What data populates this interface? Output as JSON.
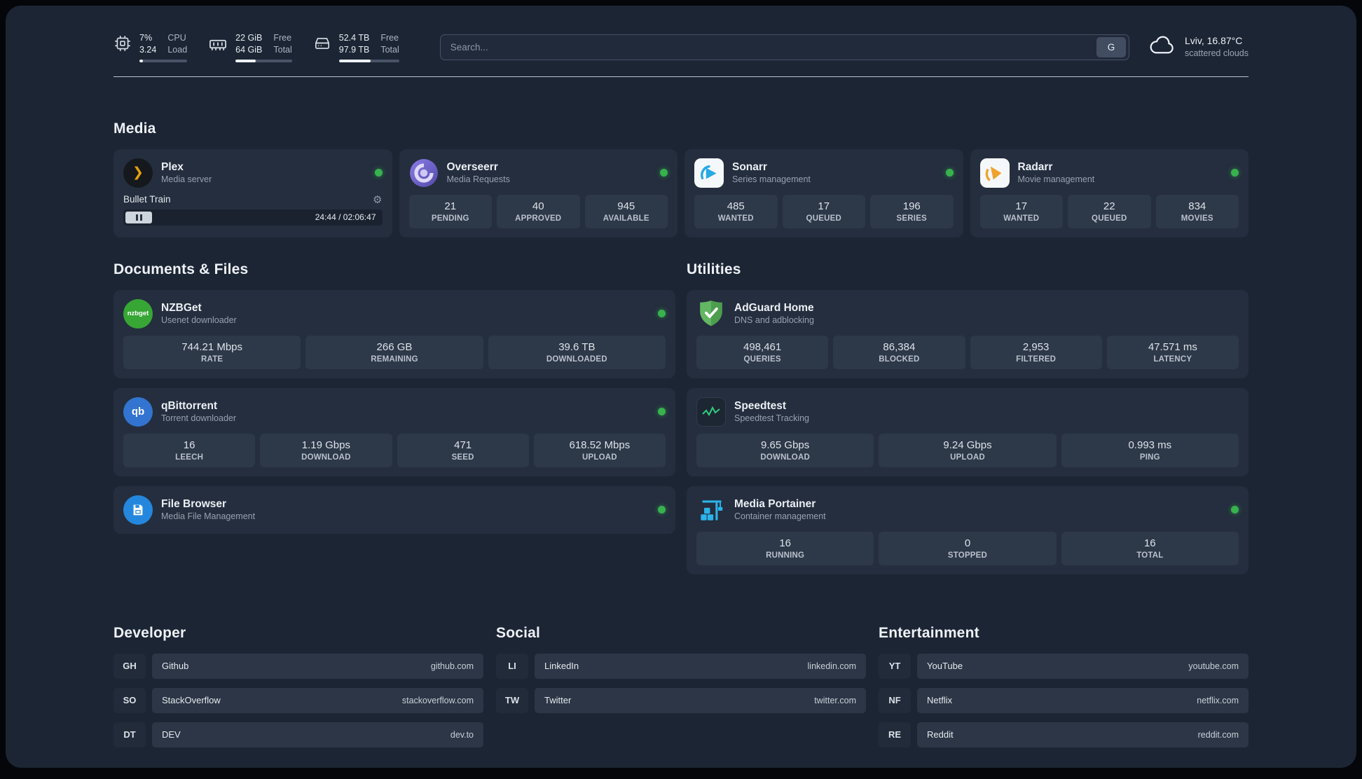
{
  "topbar": {
    "cpu": {
      "value": "7%",
      "sub": "3.24",
      "labels": [
        "CPU",
        "Load"
      ],
      "progress": 8
    },
    "ram": {
      "value": "22 GiB",
      "sub": "64 GiB",
      "labels": [
        "Free",
        "Total"
      ],
      "progress": 36
    },
    "disk": {
      "value": "52.4 TB",
      "sub": "97.9 TB",
      "labels": [
        "Free",
        "Total"
      ],
      "progress": 53
    },
    "search": {
      "placeholder": "Search...",
      "button_label": "G"
    },
    "weather": {
      "location": "Lviv, 16.87°C",
      "condition": "scattered clouds"
    }
  },
  "sections": {
    "media": "Media",
    "documents": "Documents & Files",
    "utilities": "Utilities",
    "developer": "Developer",
    "social": "Social",
    "entertainment": "Entertainment"
  },
  "apps": {
    "plex": {
      "name": "Plex",
      "subtitle": "Media server",
      "now_playing": "Bullet Train",
      "time": "24:44 / 02:06:47"
    },
    "overseerr": {
      "name": "Overseerr",
      "subtitle": "Media Requests",
      "stats": [
        {
          "value": "21",
          "label": "PENDING"
        },
        {
          "value": "40",
          "label": "APPROVED"
        },
        {
          "value": "945",
          "label": "AVAILABLE"
        }
      ]
    },
    "sonarr": {
      "name": "Sonarr",
      "subtitle": "Series management",
      "stats": [
        {
          "value": "485",
          "label": "WANTED"
        },
        {
          "value": "17",
          "label": "QUEUED"
        },
        {
          "value": "196",
          "label": "SERIES"
        }
      ]
    },
    "radarr": {
      "name": "Radarr",
      "subtitle": "Movie management",
      "stats": [
        {
          "value": "17",
          "label": "WANTED"
        },
        {
          "value": "22",
          "label": "QUEUED"
        },
        {
          "value": "834",
          "label": "MOVIES"
        }
      ]
    },
    "nzbget": {
      "name": "NZBGet",
      "subtitle": "Usenet downloader",
      "stats": [
        {
          "value": "744.21 Mbps",
          "label": "RATE"
        },
        {
          "value": "266 GB",
          "label": "REMAINING"
        },
        {
          "value": "39.6 TB",
          "label": "DOWNLOADED"
        }
      ]
    },
    "qbittorrent": {
      "name": "qBittorrent",
      "subtitle": "Torrent downloader",
      "stats": [
        {
          "value": "16",
          "label": "LEECH"
        },
        {
          "value": "1.19 Gbps",
          "label": "DOWNLOAD"
        },
        {
          "value": "471",
          "label": "SEED"
        },
        {
          "value": "618.52 Mbps",
          "label": "UPLOAD"
        }
      ]
    },
    "filebrowser": {
      "name": "File Browser",
      "subtitle": "Media File Management"
    },
    "adguard": {
      "name": "AdGuard Home",
      "subtitle": "DNS and adblocking",
      "stats": [
        {
          "value": "498,461",
          "label": "QUERIES"
        },
        {
          "value": "86,384",
          "label": "BLOCKED"
        },
        {
          "value": "2,953",
          "label": "FILTERED"
        },
        {
          "value": "47.571 ms",
          "label": "LATENCY"
        }
      ]
    },
    "speedtest": {
      "name": "Speedtest",
      "subtitle": "Speedtest Tracking",
      "stats": [
        {
          "value": "9.65 Gbps",
          "label": "DOWNLOAD"
        },
        {
          "value": "9.24 Gbps",
          "label": "UPLOAD"
        },
        {
          "value": "0.993 ms",
          "label": "PING"
        }
      ]
    },
    "portainer": {
      "name": "Media Portainer",
      "subtitle": "Container management",
      "stats": [
        {
          "value": "16",
          "label": "RUNNING"
        },
        {
          "value": "0",
          "label": "STOPPED"
        },
        {
          "value": "16",
          "label": "TOTAL"
        }
      ]
    }
  },
  "bookmarks": {
    "developer": [
      {
        "abbr": "GH",
        "name": "Github",
        "url": "github.com"
      },
      {
        "abbr": "SO",
        "name": "StackOverflow",
        "url": "stackoverflow.com"
      },
      {
        "abbr": "DT",
        "name": "DEV",
        "url": "dev.to"
      }
    ],
    "social": [
      {
        "abbr": "LI",
        "name": "LinkedIn",
        "url": "linkedin.com"
      },
      {
        "abbr": "TW",
        "name": "Twitter",
        "url": "twitter.com"
      }
    ],
    "entertainment": [
      {
        "abbr": "YT",
        "name": "YouTube",
        "url": "youtube.com"
      },
      {
        "abbr": "NF",
        "name": "Netflix",
        "url": "netflix.com"
      },
      {
        "abbr": "RE",
        "name": "Reddit",
        "url": "reddit.com"
      }
    ]
  },
  "icons": {
    "gear": "⚙",
    "plex_chevron": "❯",
    "nzbget_text": "nzbget",
    "qbittorrent_text": "qb"
  },
  "colors": {
    "status_online": "#37b24d",
    "plex_accent": "#e5a00d",
    "sonarr_accent": "#27a9e3",
    "radarr_accent": "#f1a22c",
    "adguard_green": "#4d9e4f",
    "portainer_blue": "#2bb3ea",
    "speedtest_green": "#2fd07e",
    "overseerr_purple": "#6c63c7",
    "nzbget_green": "#37a635",
    "qbittorrent_blue": "#3274cf",
    "filebrowser_blue": "#2487dd"
  }
}
